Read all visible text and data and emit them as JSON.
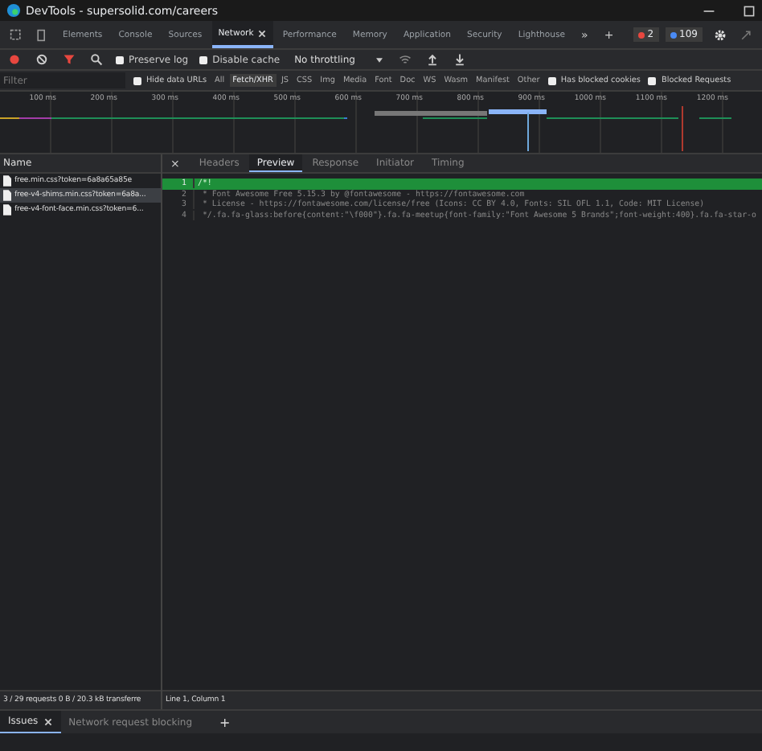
{
  "window": {
    "title": "DevTools - supersolid.com/careers"
  },
  "panel_tabs": [
    {
      "label": "Elements",
      "selected": false,
      "closable": false
    },
    {
      "label": "Console",
      "selected": false,
      "closable": false
    },
    {
      "label": "Sources",
      "selected": false,
      "closable": false
    },
    {
      "label": "Network",
      "selected": true,
      "closable": true
    },
    {
      "label": "Performance",
      "selected": false,
      "closable": false
    },
    {
      "label": "Memory",
      "selected": false,
      "closable": false
    },
    {
      "label": "Application",
      "selected": false,
      "closable": false
    },
    {
      "label": "Security",
      "selected": false,
      "closable": false
    },
    {
      "label": "Lighthouse",
      "selected": false,
      "closable": false
    }
  ],
  "more_tabs": "»",
  "add_tab": "+",
  "counters": [
    {
      "value": "2",
      "color": "#e8473f"
    },
    {
      "value": "109",
      "color": "#4a8bf5"
    }
  ],
  "toolbar": {
    "preserve_log": {
      "label": "Preserve log",
      "checked": false
    },
    "disable_cache": {
      "label": "Disable cache",
      "checked": false
    },
    "throttling": "No throttling"
  },
  "filter": {
    "placeholder": "Filter",
    "hide_data_urls": {
      "label": "Hide data URLs",
      "checked": false
    },
    "types": [
      {
        "label": "All",
        "selected": false
      },
      {
        "label": "Fetch/XHR",
        "selected": true
      },
      {
        "label": "JS",
        "selected": false
      },
      {
        "label": "CSS",
        "selected": false
      },
      {
        "label": "Img",
        "selected": false
      },
      {
        "label": "Media",
        "selected": false
      },
      {
        "label": "Font",
        "selected": false
      },
      {
        "label": "Doc",
        "selected": false
      },
      {
        "label": "WS",
        "selected": false
      },
      {
        "label": "Wasm",
        "selected": false
      },
      {
        "label": "Manifest",
        "selected": false
      },
      {
        "label": "Other",
        "selected": false
      }
    ],
    "has_blocked_cookies": {
      "label": "Has blocked cookies",
      "checked": false
    },
    "blocked_requests": {
      "label": "Blocked Requests",
      "checked": false
    }
  },
  "timeline_ticks": [
    "100 ms",
    "200 ms",
    "300 ms",
    "400 ms",
    "500 ms",
    "600 ms",
    "700 ms",
    "800 ms",
    "900 ms",
    "1000 ms",
    "1100 ms",
    "1200 ms"
  ],
  "requests": {
    "column": "Name",
    "rows": [
      {
        "name": "free.min.css?token=6a8a65a85e",
        "selected": false
      },
      {
        "name": "free-v4-shims.min.css?token=6a8a...",
        "selected": true
      },
      {
        "name": "free-v4-font-face.min.css?token=6...",
        "selected": false
      }
    ]
  },
  "detail_tabs": [
    {
      "label": "Headers",
      "selected": false
    },
    {
      "label": "Preview",
      "selected": true
    },
    {
      "label": "Response",
      "selected": false
    },
    {
      "label": "Initiator",
      "selected": false
    },
    {
      "label": "Timing",
      "selected": false
    }
  ],
  "close_detail": "×",
  "code_lines": [
    {
      "number": "1",
      "text": "/*!",
      "highlighted": true
    },
    {
      "number": "2",
      "text": " * Font Awesome Free 5.15.3 by @fontawesome - https://fontawesome.com",
      "highlighted": false
    },
    {
      "number": "3",
      "text": " * License - https://fontawesome.com/license/free (Icons: CC BY 4.0, Fonts: SIL OFL 1.1, Code: MIT License)",
      "highlighted": false
    },
    {
      "number": "4",
      "text": " */.fa.fa-glass:before{content:\"\\f000\"}.fa.fa-meetup{font-family:\"Font Awesome 5 Brands\";font-weight:400}.fa.fa-star-o",
      "highlighted": false
    }
  ],
  "status_bar": {
    "summary": "3 / 29 requests  0 B / 20.3 kB transferre",
    "cursor": "Line 1, Column 1"
  },
  "drawer_tabs": [
    {
      "label": "Issues",
      "selected": true,
      "closable": true
    },
    {
      "label": "Network request blocking",
      "selected": false,
      "closable": false
    }
  ],
  "drawer_add": "+"
}
